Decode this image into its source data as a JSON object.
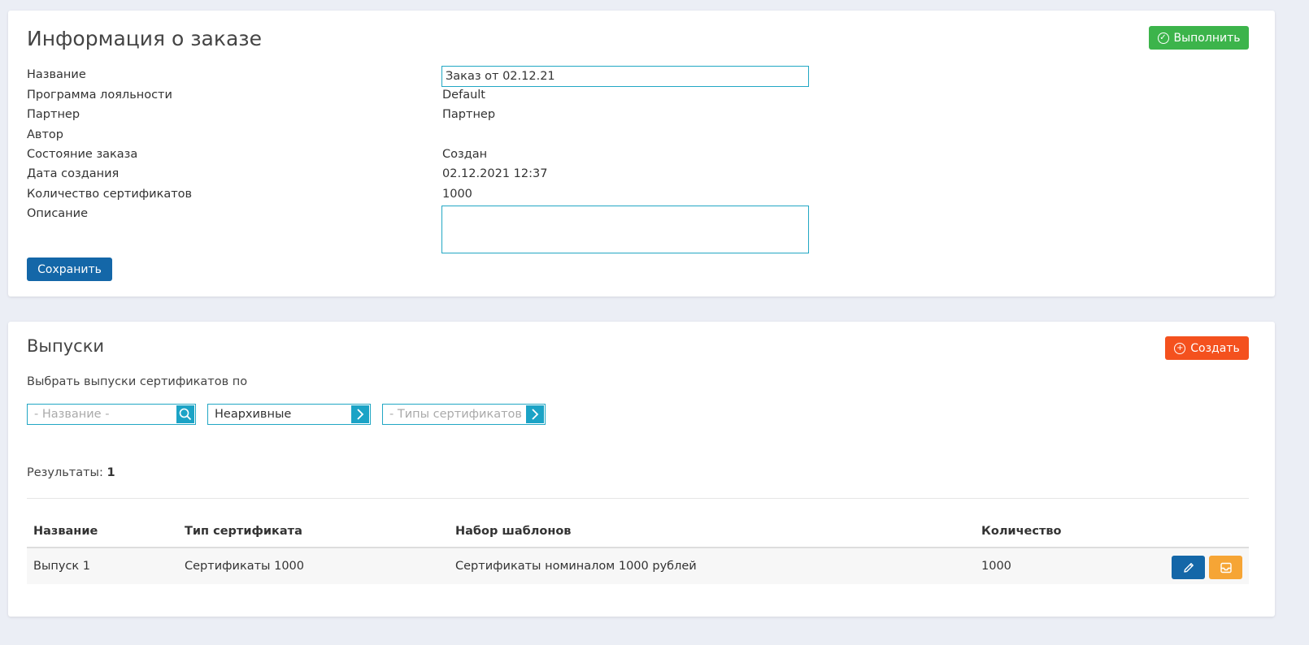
{
  "order_info": {
    "title": "Информация о заказе",
    "execute_label": "Выполнить",
    "save_label": "Сохранить",
    "fields": {
      "name_label": "Название",
      "name_value": "Заказ от 02.12.21",
      "loyalty_label": "Программа лояльности",
      "loyalty_value": "Default",
      "partner_label": "Партнер",
      "partner_value": "Партнер",
      "author_label": "Автор",
      "author_value": "",
      "state_label": "Состояние заказа",
      "state_value": "Создан",
      "created_label": "Дата создания",
      "created_value": "02.12.2021 12:37",
      "count_label": "Количество сертификатов",
      "count_value": "1000",
      "description_label": "Описание",
      "description_value": ""
    }
  },
  "issues": {
    "title": "Выпуски",
    "create_label": "Создать",
    "filter_label": "Выбрать выпуски сертификатов по",
    "filters": {
      "name_placeholder": "- Название -",
      "archive_value": "Неархивные",
      "types_placeholder": "- Типы сертификатов -"
    },
    "results_label": "Результаты:",
    "results_count": "1",
    "table": {
      "headers": [
        "Название",
        "Тип сертификата",
        "Набор шаблонов",
        "Количество"
      ],
      "rows": [
        [
          "Выпуск 1",
          "Сертификаты 1000",
          "Сертификаты номиналом 1000 рублей",
          "1000"
        ]
      ]
    }
  },
  "colors": {
    "execute": "#3cb44b",
    "create": "#f4511e",
    "save": "#1467a8",
    "edit": "#1467a8",
    "archive": "#f6a535",
    "input_border": "#22a7c4"
  },
  "icons": {
    "execute": "check-circle-icon",
    "create": "plus-circle-icon",
    "name_filter": "search-icon",
    "archive_filter": "chevron-right-icon",
    "types_filter": "chevron-right-icon",
    "edit": "pencil-icon",
    "archive": "inbox-icon"
  }
}
